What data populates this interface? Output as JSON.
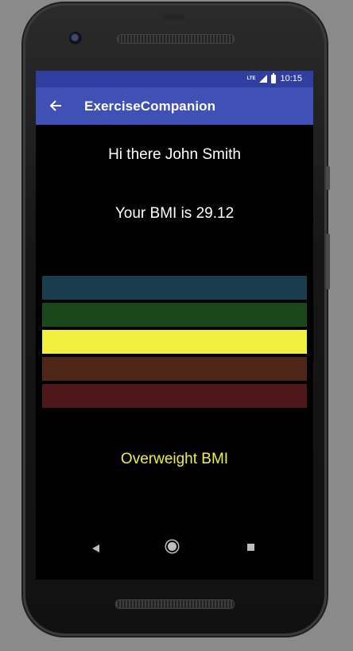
{
  "status_bar": {
    "network_label": "LTE",
    "time": "10:15",
    "icons": [
      "lte-icon",
      "signal-icon",
      "battery-icon"
    ]
  },
  "app_bar": {
    "back_icon": "arrow-left-icon",
    "title": "ExerciseCompanion"
  },
  "main": {
    "greeting": "Hi there John Smith",
    "bmi_text": "Your BMI is 29.12",
    "bmi_bars": [
      {
        "category": "underweight",
        "color": "#193d4f"
      },
      {
        "category": "normal",
        "color": "#19481c"
      },
      {
        "category": "overweight",
        "color": "#f0ef3e",
        "highlighted": true
      },
      {
        "category": "obese",
        "color": "#4e2617"
      },
      {
        "category": "extremely-obese",
        "color": "#4e1719"
      }
    ],
    "category_text": "Overweight BMI",
    "category_color": "#f0ef3e"
  },
  "nav_bar": {
    "icons": [
      "nav-back-icon",
      "nav-home-icon",
      "nav-recent-apps-icon"
    ]
  }
}
